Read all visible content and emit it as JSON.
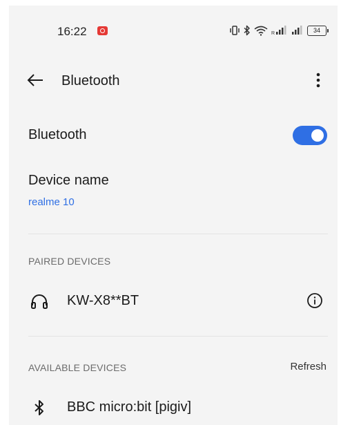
{
  "status_bar": {
    "time": "16:22",
    "battery": "34",
    "icons": [
      "screen-record-icon",
      "vibrate-icon",
      "bluetooth-icon",
      "wifi-icon",
      "signal-icon",
      "signal-icon",
      "battery-icon"
    ]
  },
  "header": {
    "title": "Bluetooth",
    "back_icon": "arrow-left-icon",
    "more_icon": "more-vertical-icon"
  },
  "bluetooth_toggle": {
    "label": "Bluetooth",
    "enabled": true,
    "accent": "#2f6fe4"
  },
  "device_name": {
    "title": "Device name",
    "value": "realme 10"
  },
  "paired": {
    "header": "PAIRED DEVICES",
    "devices": [
      {
        "name": "KW-X8**BT",
        "icon": "headphones-icon",
        "action_icon": "info-icon"
      }
    ]
  },
  "available": {
    "header": "AVAILABLE DEVICES",
    "refresh_label": "Refresh",
    "devices": [
      {
        "name": "BBC micro:bit [pigiv]",
        "icon": "bluetooth-icon"
      }
    ]
  }
}
